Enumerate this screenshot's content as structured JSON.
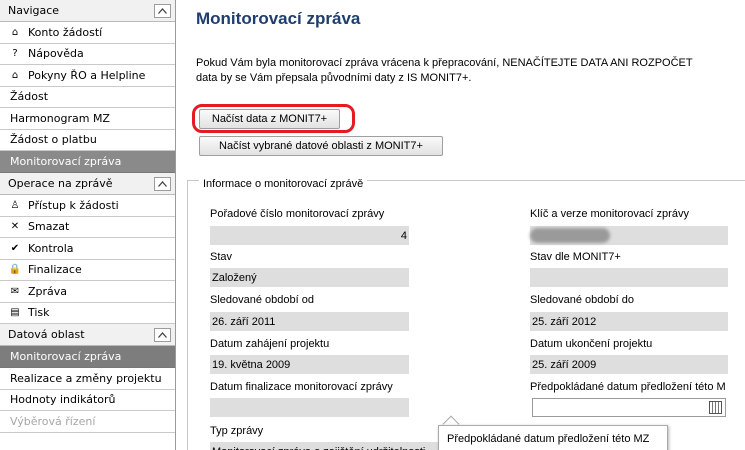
{
  "sidebar": {
    "nav_header": "Navigace",
    "nav_items": [
      {
        "label": "Konto žádostí",
        "icon": "home-icon",
        "glyph": "⌂"
      },
      {
        "label": "Nápověda",
        "icon": "help-icon",
        "glyph": "?"
      },
      {
        "label": "Pokyny ŘO a Helpline",
        "icon": "home-icon",
        "glyph": "⌂"
      }
    ],
    "plain_items": [
      "Žádost",
      "Harmonogram MZ",
      "Žádost o platbu"
    ],
    "section_monitoring": "Monitorovací zpráva",
    "ops_header": "Operace na zprávě",
    "ops_items": [
      {
        "label": "Přístup k žádosti",
        "icon": "person-icon",
        "glyph": "♙"
      },
      {
        "label": "Smazat",
        "icon": "delete-icon",
        "glyph": "✕"
      },
      {
        "label": "Kontrola",
        "icon": "check-icon",
        "glyph": "✔"
      },
      {
        "label": "Finalizace",
        "icon": "lock-icon",
        "glyph": "🔒"
      },
      {
        "label": "Zpráva",
        "icon": "mail-icon",
        "glyph": "✉"
      },
      {
        "label": "Tisk",
        "icon": "print-icon",
        "glyph": "▤"
      }
    ],
    "data_header": "Datová oblast",
    "data_active": "Monitorovací zpráva",
    "data_items": [
      "Realizace a změny projektu",
      "Hodnoty indikátorů"
    ],
    "data_disabled": "Výběrová řízení"
  },
  "main": {
    "title": "Monitorovací zpráva",
    "intro_line1": "Pokud Vám byla monitorovací zpráva vrácena k přepracování, NENAČÍTEJTE DATA ANI ROZPOČET",
    "intro_line2": "data by se Vám přepsala původními daty z IS MONIT7+.",
    "btn_load": "Načíst data z MONIT7+",
    "btn_load_selected": "Načíst vybrané datové oblasti z MONIT7+",
    "legend": "Informace o monitorovací zprávě",
    "fields": {
      "order_label": "Pořadové číslo monitorovací zprávy",
      "order_value": "4",
      "key_label": "Klíč a verze monitorovací zprávy",
      "state_label": "Stav",
      "state_value": "Založený",
      "state_monit_label": "Stav dle MONIT7+",
      "period_from_label": "Sledované období od",
      "period_from_value": "26. září 2011",
      "period_to_label": "Sledované období do",
      "period_to_value": "25. září 2012",
      "start_label": "Datum zahájení projektu",
      "start_value": "19. května 2009",
      "end_label": "Datum ukončení projektu",
      "end_value": "25. září 2009",
      "finalize_label": "Datum finalizace monitorovací zprávy",
      "expected_label": "Předpokládané datum předložení této M",
      "type_label": "Typ zprávy",
      "type_value": "Monitorovací zpráva o zajištění udržitelnosti"
    },
    "tooltip": "Předpokládané datum předložení této MZ"
  },
  "colors": {
    "title": "#1f3d6d",
    "highlight": "#e41b23",
    "section_bg": "#8a8a8a"
  }
}
